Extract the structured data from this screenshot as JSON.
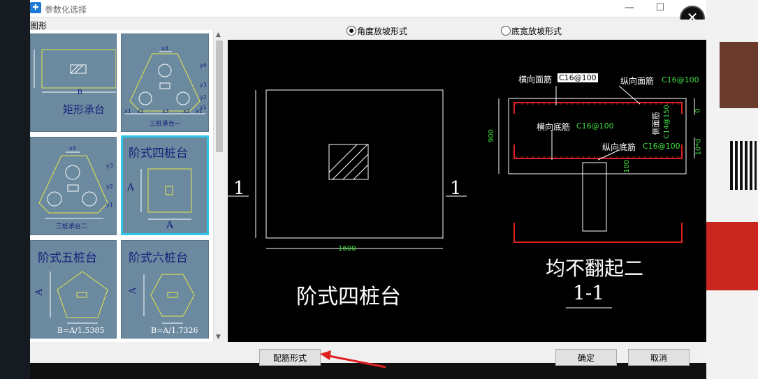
{
  "window": {
    "title": "参数化选择",
    "minimize": "—",
    "maximize": "☐",
    "close": "✕"
  },
  "left_panel": {
    "label": "图形"
  },
  "thumbnails": [
    {
      "name": "矩形承台",
      "dim": "B"
    },
    {
      "name": "三桩承台一",
      "dims": [
        "x4",
        "y4",
        "y3",
        "y2",
        "y1",
        "x1",
        "x2",
        "x3",
        "x2",
        "x1"
      ]
    },
    {
      "name": "三桩承台二",
      "dims": [
        "x4",
        "y3",
        "y2",
        "y1"
      ]
    },
    {
      "name": "阶式四桩台",
      "dims": [
        "A",
        "A"
      ]
    },
    {
      "name": "阶式五桩台",
      "dims": [
        "A",
        "B=A/1.5385"
      ]
    },
    {
      "name": "阶式六桩台",
      "dims": [
        "A",
        "B=A/1.7326"
      ]
    }
  ],
  "options": {
    "angle": "角度放坡形式",
    "width": "底宽放坡形式",
    "selected": "angle"
  },
  "drawing": {
    "plan_title": "阶式四桩台",
    "section_mark": "1",
    "plan_dim": "1600",
    "section_name": "均不翻起二",
    "section_label": "1-1",
    "top_transverse_label": "横向面筋",
    "top_transverse_value": "C16@100",
    "top_long_label": "纵向面筋",
    "top_long_value": "C16@100",
    "bottom_trans_label": "横向底筋",
    "bottom_trans_value": "C16@100",
    "bottom_long_label": "纵向底筋",
    "bottom_long_value": "C16@100",
    "side_label": "侧面筋",
    "side_value": "C14@150",
    "height_dim": "900",
    "right_dim_top": "0",
    "right_dim_bottom": "10*d",
    "inner_dim": "100"
  },
  "buttons": {
    "rebar": "配筋形式",
    "ok": "确定",
    "cancel": "取消"
  },
  "colors": {
    "canvas": "#000000",
    "thumb": "#6b8aa0",
    "selected": "#2ec6e8",
    "rebar": "#e02020",
    "dim": "#40e040",
    "annot": "#ffffff"
  }
}
